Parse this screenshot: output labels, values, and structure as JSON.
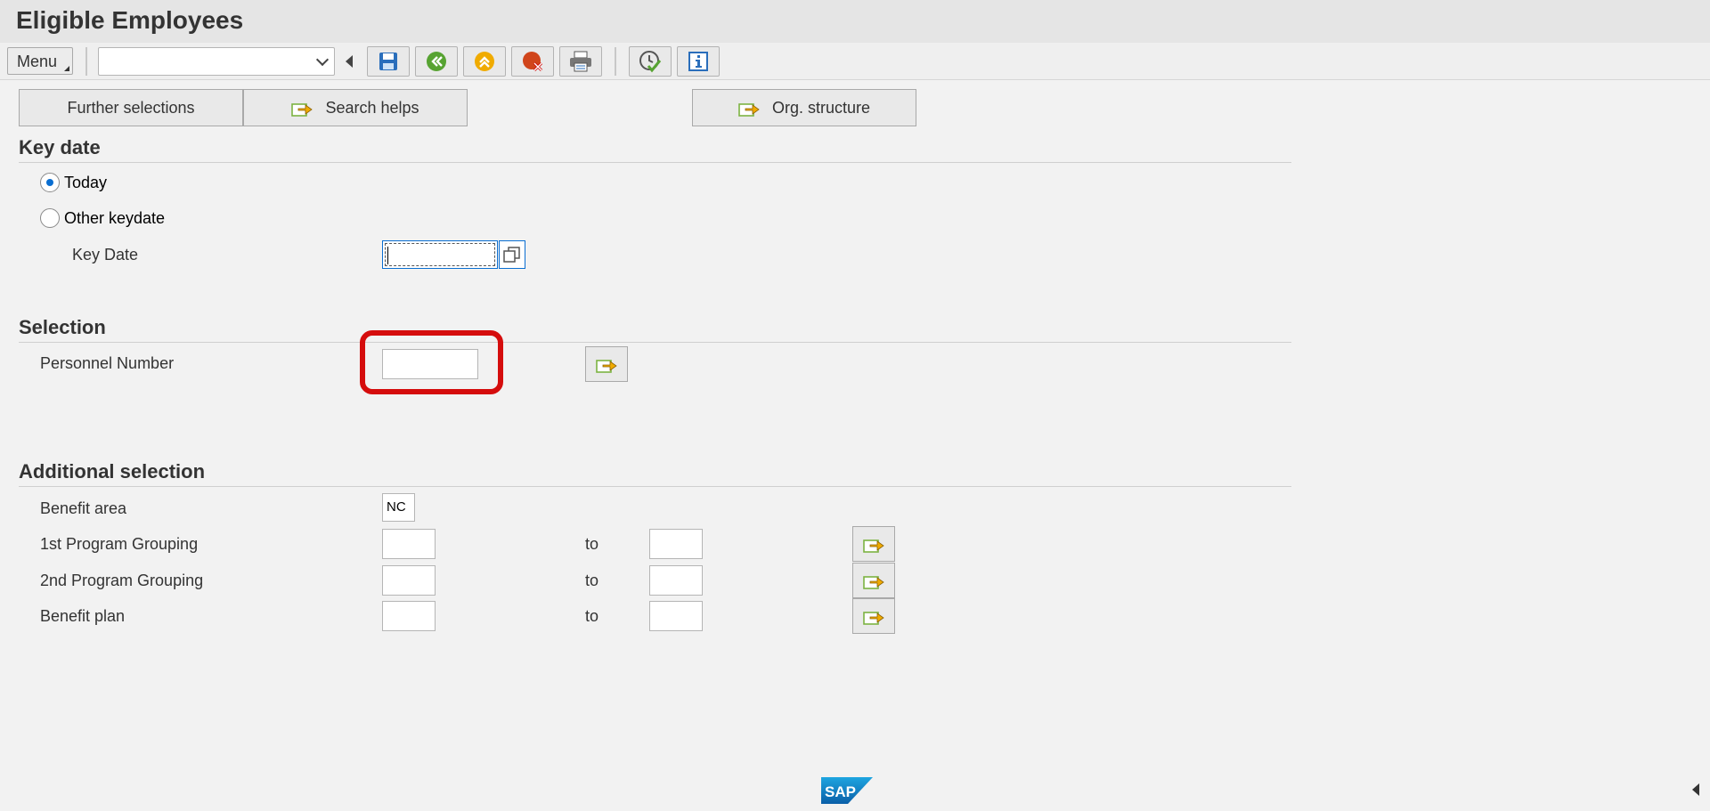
{
  "window": {
    "title": "Eligible Employees"
  },
  "toolbar": {
    "menu_label": "Menu",
    "command_field_value": "",
    "buttons": [
      {
        "name": "save-button",
        "icon": "save-icon"
      },
      {
        "name": "back-button",
        "icon": "back-icon"
      },
      {
        "name": "exit-button",
        "icon": "exit-icon"
      },
      {
        "name": "cancel-button",
        "icon": "cancel-icon"
      },
      {
        "name": "print-button",
        "icon": "print-icon"
      },
      {
        "name": "execute-button",
        "icon": "execute-icon"
      },
      {
        "name": "info-button",
        "icon": "info-icon"
      }
    ]
  },
  "segments": {
    "further_selections": "Further selections",
    "search_helps": "Search helps",
    "org_structure": "Org. structure"
  },
  "key_date_section": {
    "title": "Key date",
    "today_label": "Today",
    "today_selected": true,
    "other_label": "Other keydate",
    "key_date_label": "Key Date",
    "key_date_value": ""
  },
  "selection_section": {
    "title": "Selection",
    "personnel_number_label": "Personnel Number",
    "personnel_number_value": ""
  },
  "additional_section": {
    "title": "Additional selection",
    "benefit_area_label": "Benefit area",
    "benefit_area_value": "NC",
    "to_label": "to",
    "rows": [
      {
        "label": "1st Program Grouping",
        "from": "",
        "to": ""
      },
      {
        "label": "2nd Program Grouping",
        "from": "",
        "to": ""
      },
      {
        "label": "Benefit plan",
        "from": "",
        "to": ""
      }
    ]
  },
  "footer": {
    "logo_text": "SAP"
  },
  "colors": {
    "accent": "#0a6ed1",
    "highlight": "#d50d0d",
    "arrow": "#f0ab00",
    "folder": "#7cb342"
  }
}
